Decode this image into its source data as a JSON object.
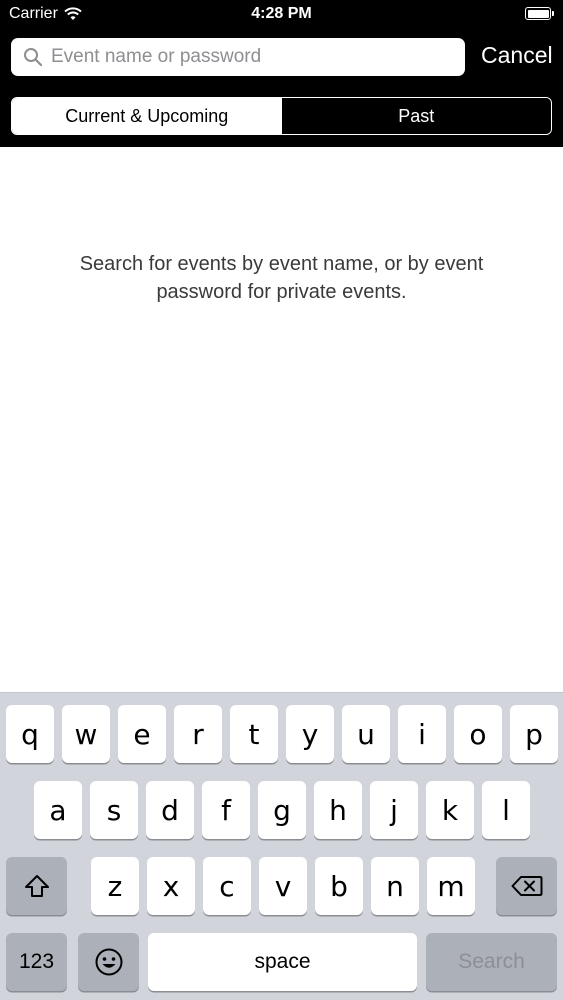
{
  "status_bar": {
    "carrier": "Carrier",
    "time": "4:28 PM",
    "wifi_icon": "wifi-icon",
    "battery_icon": "battery-full-icon"
  },
  "search": {
    "placeholder": "Event name or password",
    "value": "",
    "icon": "magnifier-icon",
    "cancel_label": "Cancel"
  },
  "segments": {
    "items": [
      {
        "label": "Current & Upcoming",
        "selected": true
      },
      {
        "label": "Past",
        "selected": false
      }
    ]
  },
  "main": {
    "hint": "Search for events by event name, or by event password for private events."
  },
  "keyboard": {
    "row1": [
      "q",
      "w",
      "e",
      "r",
      "t",
      "y",
      "u",
      "i",
      "o",
      "p"
    ],
    "row2": [
      "a",
      "s",
      "d",
      "f",
      "g",
      "h",
      "j",
      "k",
      "l"
    ],
    "row3": [
      "z",
      "x",
      "c",
      "v",
      "b",
      "n",
      "m"
    ],
    "shift_icon": "shift-arrow-icon",
    "delete_icon": "delete-backspace-icon",
    "numbers_label": "123",
    "emoji_icon": "emoji-smiley-icon",
    "space_label": "space",
    "search_label": "Search"
  },
  "colors": {
    "header_bg": "#000000",
    "keyboard_bg": "#d1d5db",
    "key_bg": "#ffffff",
    "key_dark_bg": "#abb0b9"
  }
}
